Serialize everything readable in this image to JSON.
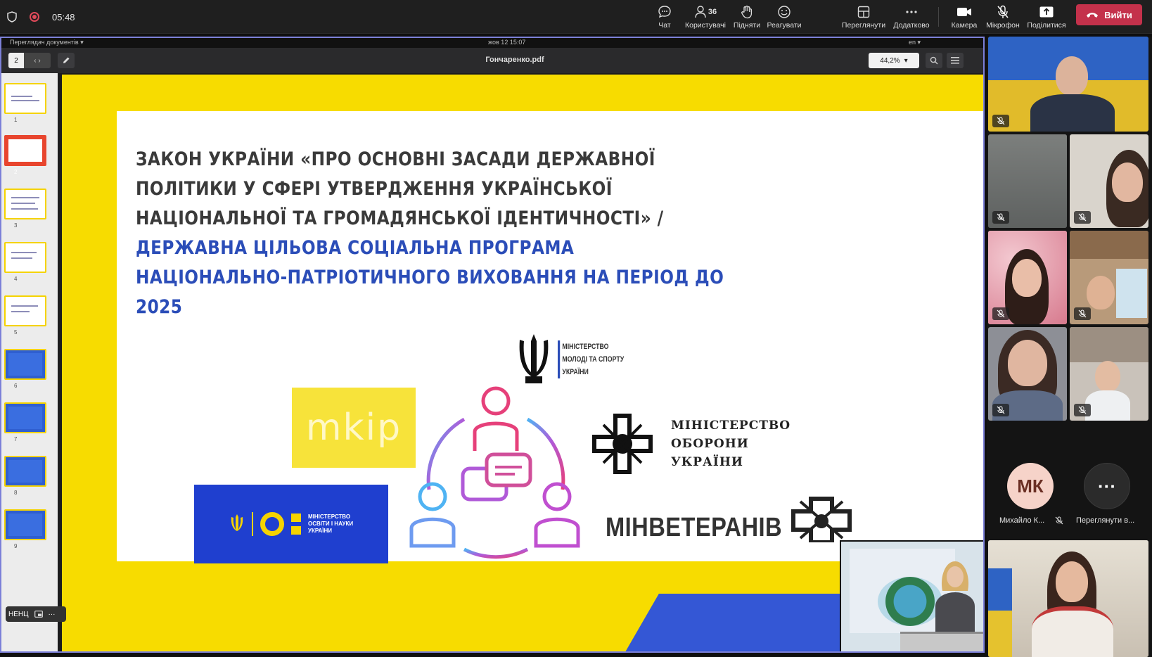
{
  "status": {
    "time": "05:48"
  },
  "toolbar": {
    "chat": "Чат",
    "people": "Користувачі",
    "people_count": "36",
    "raise": "Підняти",
    "react": "Реагувати",
    "view": "Переглянути",
    "more": "Додатково",
    "camera": "Камера",
    "mic": "Мікрофон",
    "share": "Поділитися",
    "leave": "Вийти"
  },
  "viewer": {
    "app_name": "Переглядач документів ▾",
    "datetime": "жов 12  15:07",
    "lang": "en ▾",
    "page": "2",
    "page_arrows": "‹ ›",
    "filename": "Гончаренко.pdf",
    "zoom": "44,2%",
    "thumbs": [
      "1",
      "2",
      "3",
      "4",
      "5",
      "6",
      "7",
      "8",
      "9"
    ]
  },
  "slide": {
    "title_dark": "ЗАКОН УКРАЇНИ «ПРО ОСНОВНІ ЗАСАДИ ДЕРЖАВНОЇ ПОЛІТИКИ У СФЕРІ УТВЕРДЖЕННЯ УКРАЇНСЬКОЇ НАЦІОНАЛЬНОЇ ТА ГРОМАДЯНСЬКОЇ ІДЕНТИЧНОСТІ»  /  ",
    "title_blue": "ДЕРЖАВНА ЦІЛЬОВА СОЦІАЛЬНА ПРОГРАМА НАЦІОНАЛЬНО-ПАТРІОТИЧНОГО ВИХОВАННЯ НА ПЕРІОД ДО 2025",
    "mkip": "mkip",
    "mon_text": "МІНІСТЕРСТВО ОСВІТИ І НАУКИ УКРАЇНИ",
    "sport_line1": "МІНІСТЕРСТВО",
    "sport_line2": "МОЛОДІ ТА СПОРТУ",
    "sport_line3": "УКРАЇНИ",
    "def_line1": "МІНІСТЕРСТВО",
    "def_line2": "ОБОРОНИ",
    "def_line3": "УКРАЇНИ",
    "minvet": "МІНВЕТЕРАНІВ"
  },
  "stage_label": "НЕНЦ",
  "stage_more": "···",
  "participants": {
    "mk_initials": "МК",
    "mk_name": "Михайло К...",
    "more_label": "Переглянути в...",
    "more_glyph": "···"
  },
  "colors": {
    "slide_yellow": "#f7dc00",
    "slide_blue": "#3457d5",
    "leave_red": "#c4314b",
    "stage_border": "#7c80d8"
  }
}
